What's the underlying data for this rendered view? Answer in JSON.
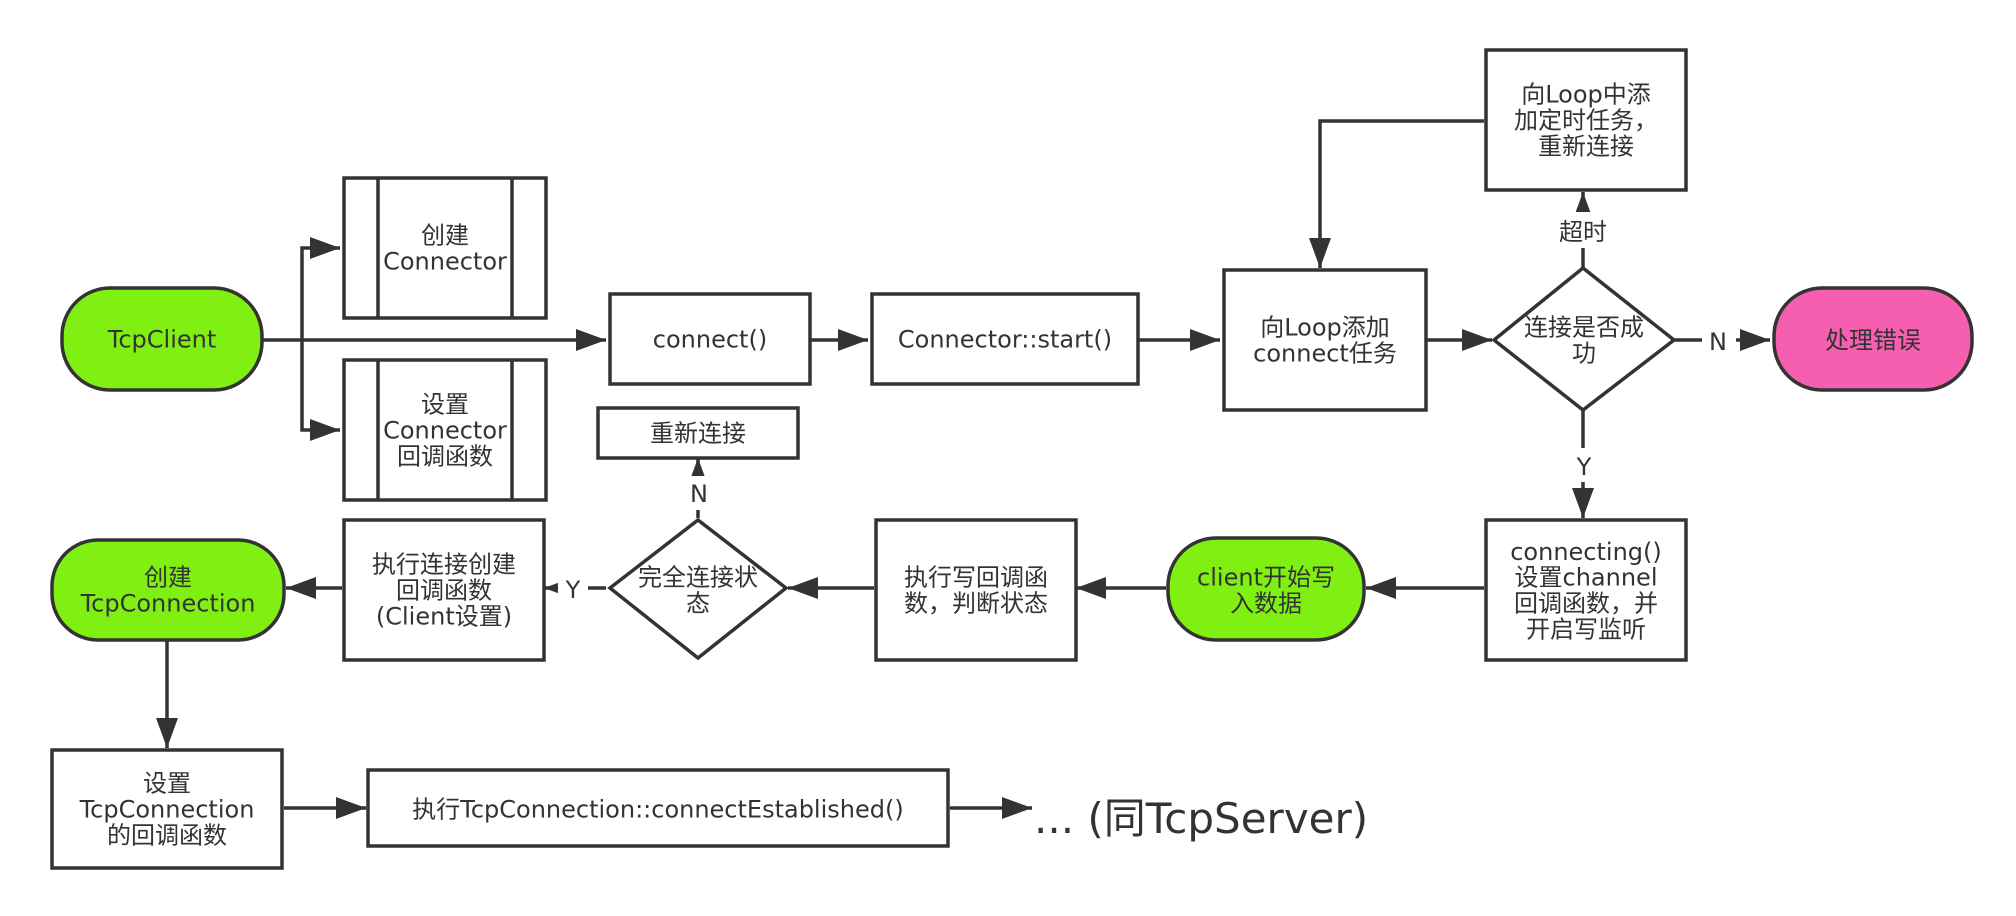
{
  "colors": {
    "terminal_green": "#80f012",
    "terminal_pink": "#f65fb0",
    "stroke": "#333333",
    "box_fill": "#ffffff",
    "text": "#333333"
  },
  "nodes": {
    "tcpclient": {
      "lines": [
        "TcpClient"
      ]
    },
    "create_connector": {
      "lines": [
        "创建",
        "Connector"
      ]
    },
    "set_connector_callback": {
      "lines": [
        "设置",
        "Connector",
        "回调函数"
      ]
    },
    "connect_call": {
      "lines": [
        "connect()"
      ]
    },
    "connector_start": {
      "lines": [
        "Connector::start()"
      ]
    },
    "add_connect_task": {
      "lines": [
        "向Loop添加",
        "connect任务"
      ]
    },
    "connect_success_decision": {
      "lines": [
        "连接是否成",
        "功"
      ]
    },
    "add_timer_task": {
      "lines": [
        "向Loop中添",
        "加定时任务，",
        "重新连接"
      ]
    },
    "handle_error": {
      "lines": [
        "处理错误"
      ]
    },
    "connecting": {
      "lines": [
        "connecting()",
        "设置channel",
        "回调函数，并",
        "开启写监听"
      ]
    },
    "client_start_write": {
      "lines": [
        "client开始写",
        "入数据"
      ]
    },
    "exec_write_callback": {
      "lines": [
        "执行写回调函",
        "数，判断状态"
      ]
    },
    "full_connect_decision": {
      "lines": [
        "完全连接状",
        "态"
      ]
    },
    "reconnect": {
      "lines": [
        "重新连接"
      ]
    },
    "exec_connection_callback": {
      "lines": [
        "执行连接创建",
        "回调函数",
        "(Client设置)"
      ]
    },
    "create_tcpconnection": {
      "lines": [
        "创建",
        "TcpConnection"
      ]
    },
    "set_tcpconnection_callback": {
      "lines": [
        "设置",
        "TcpConnection",
        "的回调函数"
      ]
    },
    "exec_connect_established": {
      "lines": [
        "执行TcpConnection::connectEstablished()"
      ]
    },
    "same_as_server": {
      "lines": [
        "... (同TcpServer)"
      ]
    }
  },
  "edge_labels": {
    "timeout": "超时",
    "no_error": "N",
    "yes_connecting": "Y",
    "no_reconnect": "N",
    "yes_connection_callback": "Y"
  }
}
